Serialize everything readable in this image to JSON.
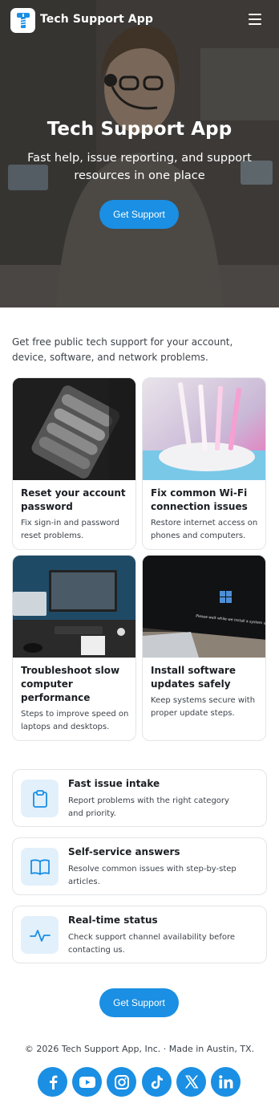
{
  "app": {
    "name": "Tech Support App"
  },
  "hero": {
    "title": "Tech Support App",
    "subtitle": "Fast help, issue reporting, and support resources in one place",
    "cta_label": "Get Support"
  },
  "intro": "Get free public tech support for your account, device, software, and network problems.",
  "cards": [
    {
      "title": "Reset your account password",
      "desc": "Fix sign-in and password reset problems."
    },
    {
      "title": "Fix common Wi-Fi connection issues",
      "desc": "Restore internet access on phones and computers."
    },
    {
      "title": "Troubleshoot slow computer performance",
      "desc": "Steps to improve speed on laptops and desktops."
    },
    {
      "title": "Install software updates safely",
      "desc": "Keep systems secure with proper update steps.",
      "screen_text": "Please wait while we install a system update"
    }
  ],
  "features": [
    {
      "icon": "clipboard-icon",
      "title": "Fast issue intake",
      "desc": "Report problems with the right category and priority."
    },
    {
      "icon": "book-icon",
      "title": "Self-service answers",
      "desc": "Resolve common issues with step-by-step articles."
    },
    {
      "icon": "activity-icon",
      "title": "Real-time status",
      "desc": "Check support channel availability before contacting us."
    }
  ],
  "bottom_cta_label": "Get Support",
  "footer": "© 2026 Tech Support App, Inc. · Made in Austin, TX.",
  "social": [
    "facebook-icon",
    "youtube-icon",
    "instagram-icon",
    "tiktok-icon",
    "x-icon",
    "linkedin-icon"
  ],
  "colors": {
    "accent": "#1a8fe3",
    "icon_bg": "#e2f0fb",
    "border": "#e2e5e8"
  }
}
